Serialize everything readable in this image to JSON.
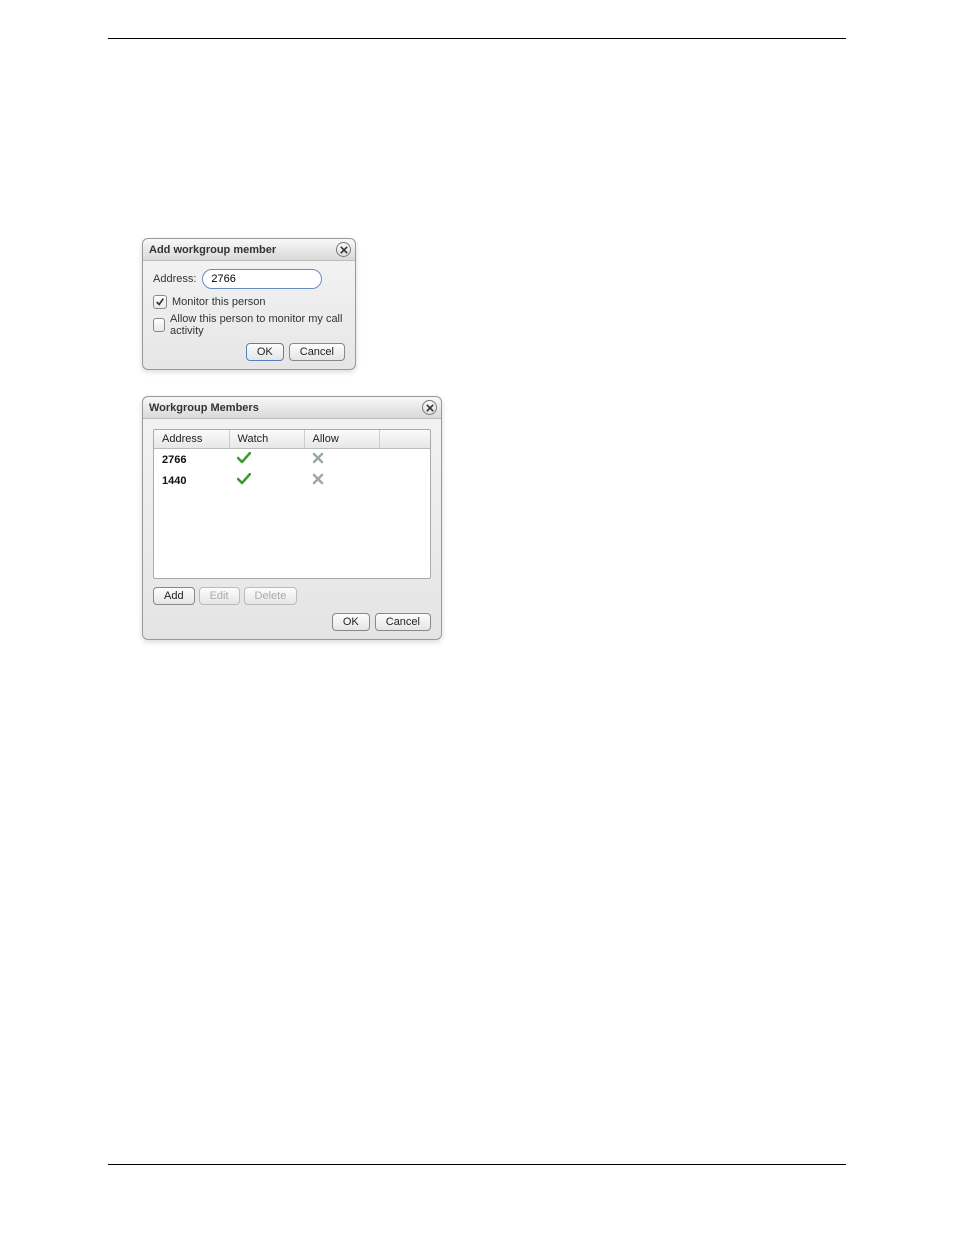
{
  "dialog1": {
    "title": "Add workgroup member",
    "address_label": "Address:",
    "address_value": "2766",
    "monitor_label": "Monitor this person",
    "monitor_checked": true,
    "allow_label": "Allow this person to monitor my call activity",
    "allow_checked": false,
    "ok_label": "OK",
    "cancel_label": "Cancel"
  },
  "dialog2": {
    "title": "Workgroup Members",
    "columns": {
      "address": "Address",
      "watch": "Watch",
      "allow": "Allow"
    },
    "rows": [
      {
        "address": "2766",
        "watch": true,
        "allow": false
      },
      {
        "address": "1440",
        "watch": true,
        "allow": false
      }
    ],
    "add_label": "Add",
    "edit_label": "Edit",
    "delete_label": "Delete",
    "ok_label": "OK",
    "cancel_label": "Cancel"
  }
}
